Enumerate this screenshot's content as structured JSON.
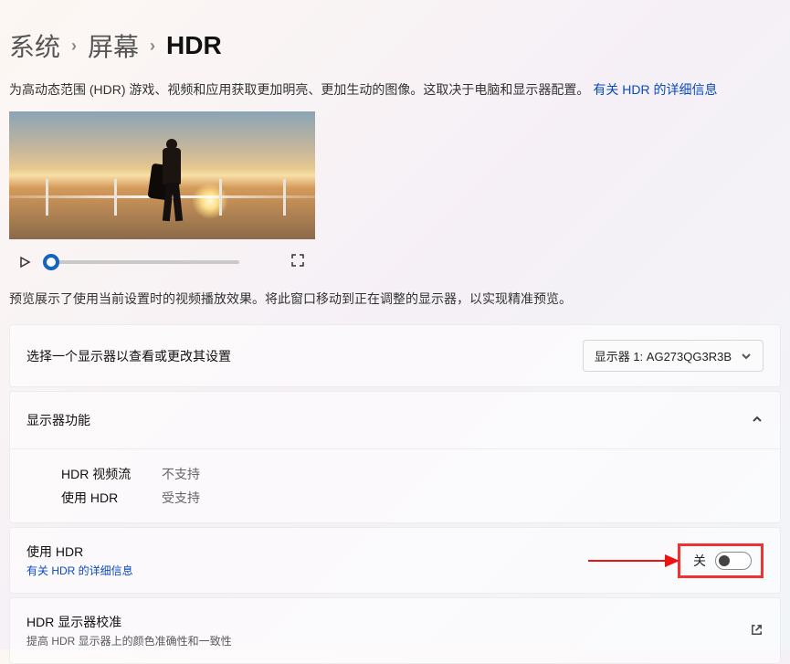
{
  "breadcrumb": {
    "system": "系统",
    "display": "屏幕",
    "current": "HDR"
  },
  "description": {
    "text": "为高动态范围 (HDR) 游戏、视频和应用获取更加明亮、更加生动的图像。这取决于电脑和显示器配置。",
    "link": "有关 HDR 的详细信息"
  },
  "preview_note": "预览展示了使用当前设置时的视频播放效果。将此窗口移动到正在调整的显示器，以实现精准预览。",
  "display_select": {
    "label": "选择一个显示器以查看或更改其设置",
    "selected": "显示器 1: AG273QG3R3B"
  },
  "capabilities": {
    "header": "显示器功能",
    "rows": [
      {
        "key": "HDR 视频流",
        "value": "不支持"
      },
      {
        "key": "使用 HDR",
        "value": "受支持"
      }
    ]
  },
  "use_hdr": {
    "title": "使用 HDR",
    "link": "有关 HDR 的详细信息",
    "state": "关"
  },
  "calibration": {
    "title": "HDR 显示器校准",
    "sub": "提高 HDR 显示器上的颜色准确性和一致性"
  }
}
